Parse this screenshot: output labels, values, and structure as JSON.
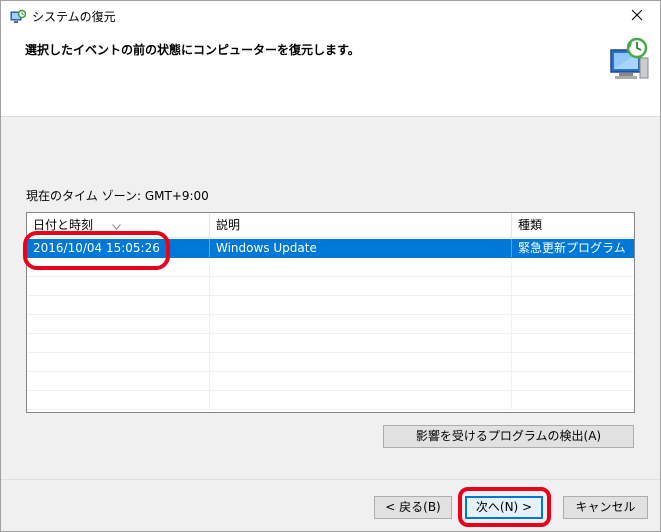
{
  "window": {
    "title": "システムの復元",
    "close_label": "×"
  },
  "header": {
    "instruction": "選択したイベントの前の状態にコンピューターを復元します。"
  },
  "timezone": {
    "label": "現在のタイム ゾーン: GMT+9:00"
  },
  "table": {
    "columns": [
      "日付と時刻",
      "説明",
      "種類"
    ],
    "rows": [
      {
        "date": "2016/10/04 15:05:26",
        "description": "Windows Update",
        "type": "緊急更新プログラム",
        "selected": true
      }
    ],
    "empty_rows": 8
  },
  "buttons": {
    "detect": "影響を受けるプログラムの検出(A)",
    "back": "< 戻る(B)",
    "next": "次へ(N) >",
    "cancel": "キャンセル"
  },
  "colors": {
    "selection": "#0078d7",
    "annotation": "#e8001c"
  },
  "icons": {
    "title": "system-restore-icon",
    "header": "monitor-restore-icon",
    "close": "close-icon",
    "sort": "sort-down-icon"
  }
}
